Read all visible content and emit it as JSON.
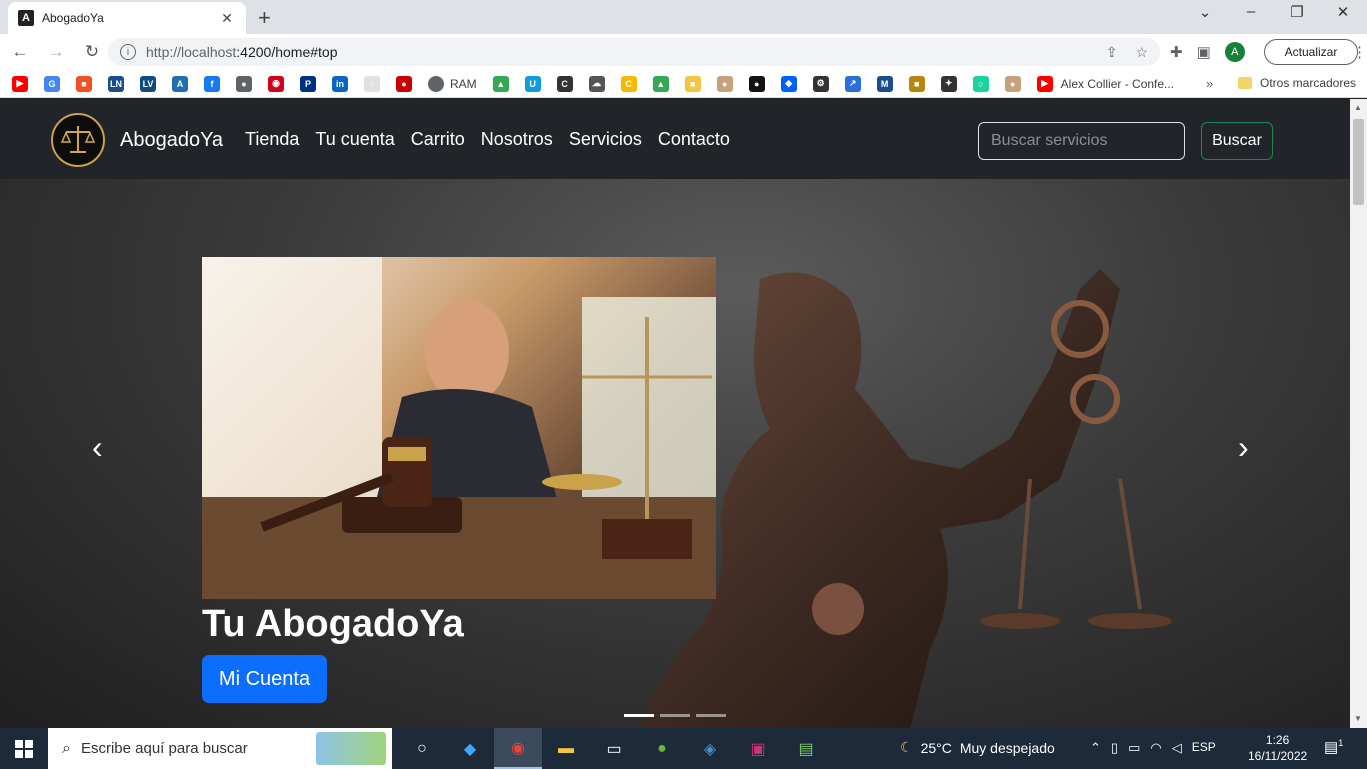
{
  "browser": {
    "tab_title": "AbogadoYa",
    "tab_favicon": "A",
    "url_host": "http://localhost",
    "url_rest": ":4200/home#top",
    "update_label": "Actualizar",
    "profile_initial": "A"
  },
  "bookmarks": {
    "items": [
      {
        "icon": "youtube-icon",
        "color": "#ff0000",
        "glyph": "▶"
      },
      {
        "icon": "google-icon",
        "color": "#4285f4",
        "glyph": "G"
      },
      {
        "icon": "microsoft-icon",
        "color": "#f25022",
        "glyph": "■"
      },
      {
        "icon": "ln-icon",
        "color": "#1a4d8f",
        "glyph": "LN"
      },
      {
        "icon": "lv-icon",
        "color": "#0f4c81",
        "glyph": "LV"
      },
      {
        "icon": "afip-icon",
        "color": "#1f6fb2",
        "glyph": "A"
      },
      {
        "icon": "facebook-icon",
        "color": "#1877f2",
        "glyph": "f"
      },
      {
        "icon": "globe-icon",
        "color": "#5f6368",
        "glyph": "●"
      },
      {
        "icon": "bank-icon",
        "color": "#d0021b",
        "glyph": "◉"
      },
      {
        "icon": "paypal-icon",
        "color": "#003087",
        "glyph": "P"
      },
      {
        "icon": "linkedin-icon",
        "color": "#0a66c2",
        "glyph": "in"
      },
      {
        "icon": "circle-icon",
        "color": "#e0e0e0",
        "glyph": "○"
      },
      {
        "icon": "record-icon",
        "color": "#c00",
        "glyph": "●"
      }
    ],
    "ram_label": "RAM",
    "items_after": [
      {
        "icon": "drive-icon",
        "color": "#34a853",
        "glyph": "▲"
      },
      {
        "icon": "u-icon",
        "color": "#0e9ddb",
        "glyph": "U"
      },
      {
        "icon": "doc-icon",
        "color": "#333",
        "glyph": "C"
      },
      {
        "icon": "cloud-icon",
        "color": "#555",
        "glyph": "☁"
      },
      {
        "icon": "c-icon",
        "color": "#f6b800",
        "glyph": "C"
      },
      {
        "icon": "drive-icon-2",
        "color": "#34a853",
        "glyph": "▲"
      },
      {
        "icon": "note-icon",
        "color": "#f4c542",
        "glyph": "■"
      },
      {
        "icon": "avatar-icon",
        "color": "#c8a07a",
        "glyph": "●"
      },
      {
        "icon": "github-icon",
        "color": "#111",
        "glyph": "●"
      },
      {
        "icon": "dropbox-icon",
        "color": "#0061ff",
        "glyph": "◆"
      },
      {
        "icon": "settings-icon",
        "color": "#333",
        "glyph": "⚙"
      },
      {
        "icon": "share-icon",
        "color": "#2a6fdb",
        "glyph": "↗"
      },
      {
        "icon": "mvn-icon",
        "color": "#1a4d8f",
        "glyph": "M"
      },
      {
        "icon": "box-icon",
        "color": "#b8860b",
        "glyph": "■"
      },
      {
        "icon": "sparkle-icon",
        "color": "#333",
        "glyph": "✦"
      },
      {
        "icon": "circle-green-icon",
        "color": "#1dd1a1",
        "glyph": "○"
      },
      {
        "icon": "avatar-icon-2",
        "color": "#c8a07a",
        "glyph": "●"
      },
      {
        "icon": "youtube-icon-2",
        "color": "#ff0000",
        "glyph": "▶"
      }
    ],
    "last_label": "Alex Collier - Confe...",
    "more": "»",
    "other_label": "Otros marcadores"
  },
  "site": {
    "brand": "AbogadoYa",
    "nav": [
      "Tienda",
      "Tu cuenta",
      "Carrito",
      "Nosotros",
      "Servicios",
      "Contacto"
    ],
    "search_placeholder": "Buscar servicios",
    "search_button": "Buscar"
  },
  "carousel": {
    "caption_title": "Tu AbogadoYa",
    "caption_button": "Mi Cuenta",
    "prev": "‹",
    "next": "›",
    "active_index": 0,
    "indicator_count": 3
  },
  "taskbar": {
    "search_placeholder": "Escribe aquí para buscar",
    "weather_temp": "25°C",
    "weather_desc": "Muy despejado",
    "lang": "ESP",
    "time": "1:26",
    "date": "16/11/2022",
    "notifications": "1"
  }
}
